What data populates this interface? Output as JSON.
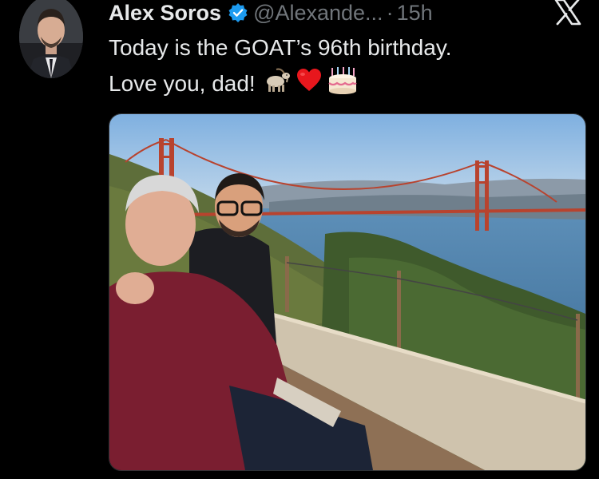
{
  "tweet": {
    "author_name": "Alex Soros",
    "handle": "@Alexande...",
    "separator": "·",
    "time": "15h",
    "text_line1": "Today is the GOAT’s 96th birthday.",
    "text_line2": "Love you, dad!",
    "emojis": [
      "goat-emoji",
      "red-heart-emoji",
      "birthday-cake-emoji"
    ]
  },
  "icons": {
    "verified": "verified-badge-icon",
    "platform": "x-logo-icon"
  },
  "colors": {
    "background": "#000000",
    "text_primary": "#e7e9ea",
    "text_secondary": "#71767b",
    "verified_blue": "#1d9bf0"
  }
}
